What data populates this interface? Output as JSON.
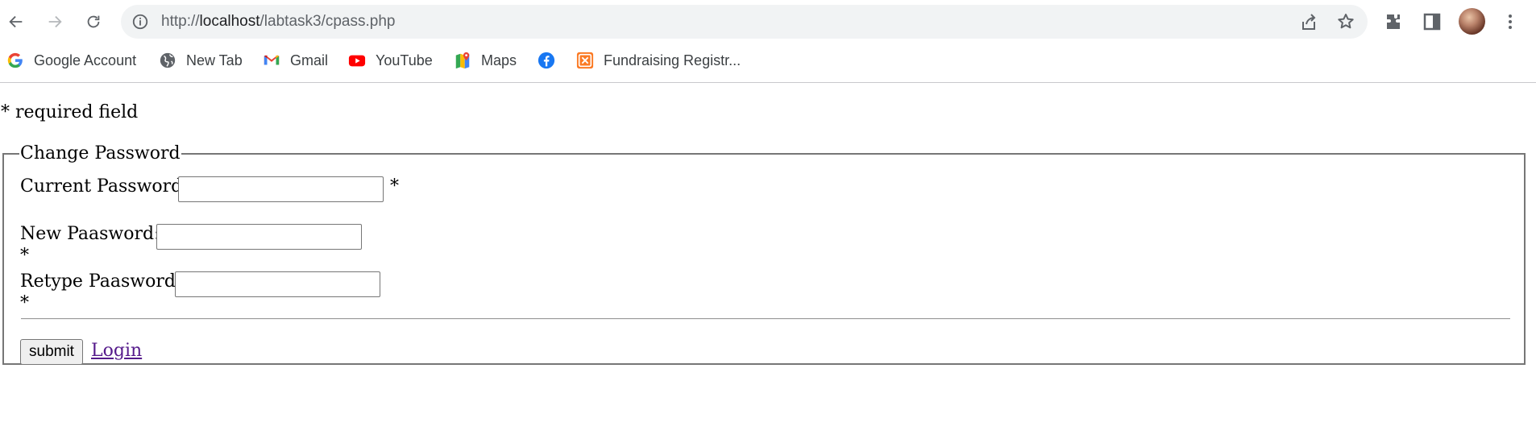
{
  "browser": {
    "url_prefix": "http://",
    "url_host": "localhost",
    "url_path": "/labtask3/cpass.php",
    "bookmarks": [
      {
        "label": "Google Account",
        "icon": "google-icon"
      },
      {
        "label": "New Tab",
        "icon": "globe-icon"
      },
      {
        "label": "Gmail",
        "icon": "gmail-icon"
      },
      {
        "label": "YouTube",
        "icon": "youtube-icon"
      },
      {
        "label": "Maps",
        "icon": "maps-icon"
      },
      {
        "label": "",
        "icon": "facebook-icon"
      },
      {
        "label": "Fundraising Registr...",
        "icon": "xampp-icon"
      }
    ]
  },
  "page": {
    "required_note": "* required field",
    "form": {
      "legend": "Change Password",
      "current_password_label": "Current Password:",
      "current_password_value": "",
      "new_password_label": "New Paasword:",
      "new_password_value": "",
      "retype_password_label": "Retype Paasword:",
      "retype_password_value": "",
      "required_mark": "*",
      "submit_label": "submit",
      "login_link": "Login"
    }
  },
  "colors": {
    "omnibox_bg": "#f1f3f4",
    "link_visited": "#551a8b",
    "fieldset_border": "#767676"
  }
}
